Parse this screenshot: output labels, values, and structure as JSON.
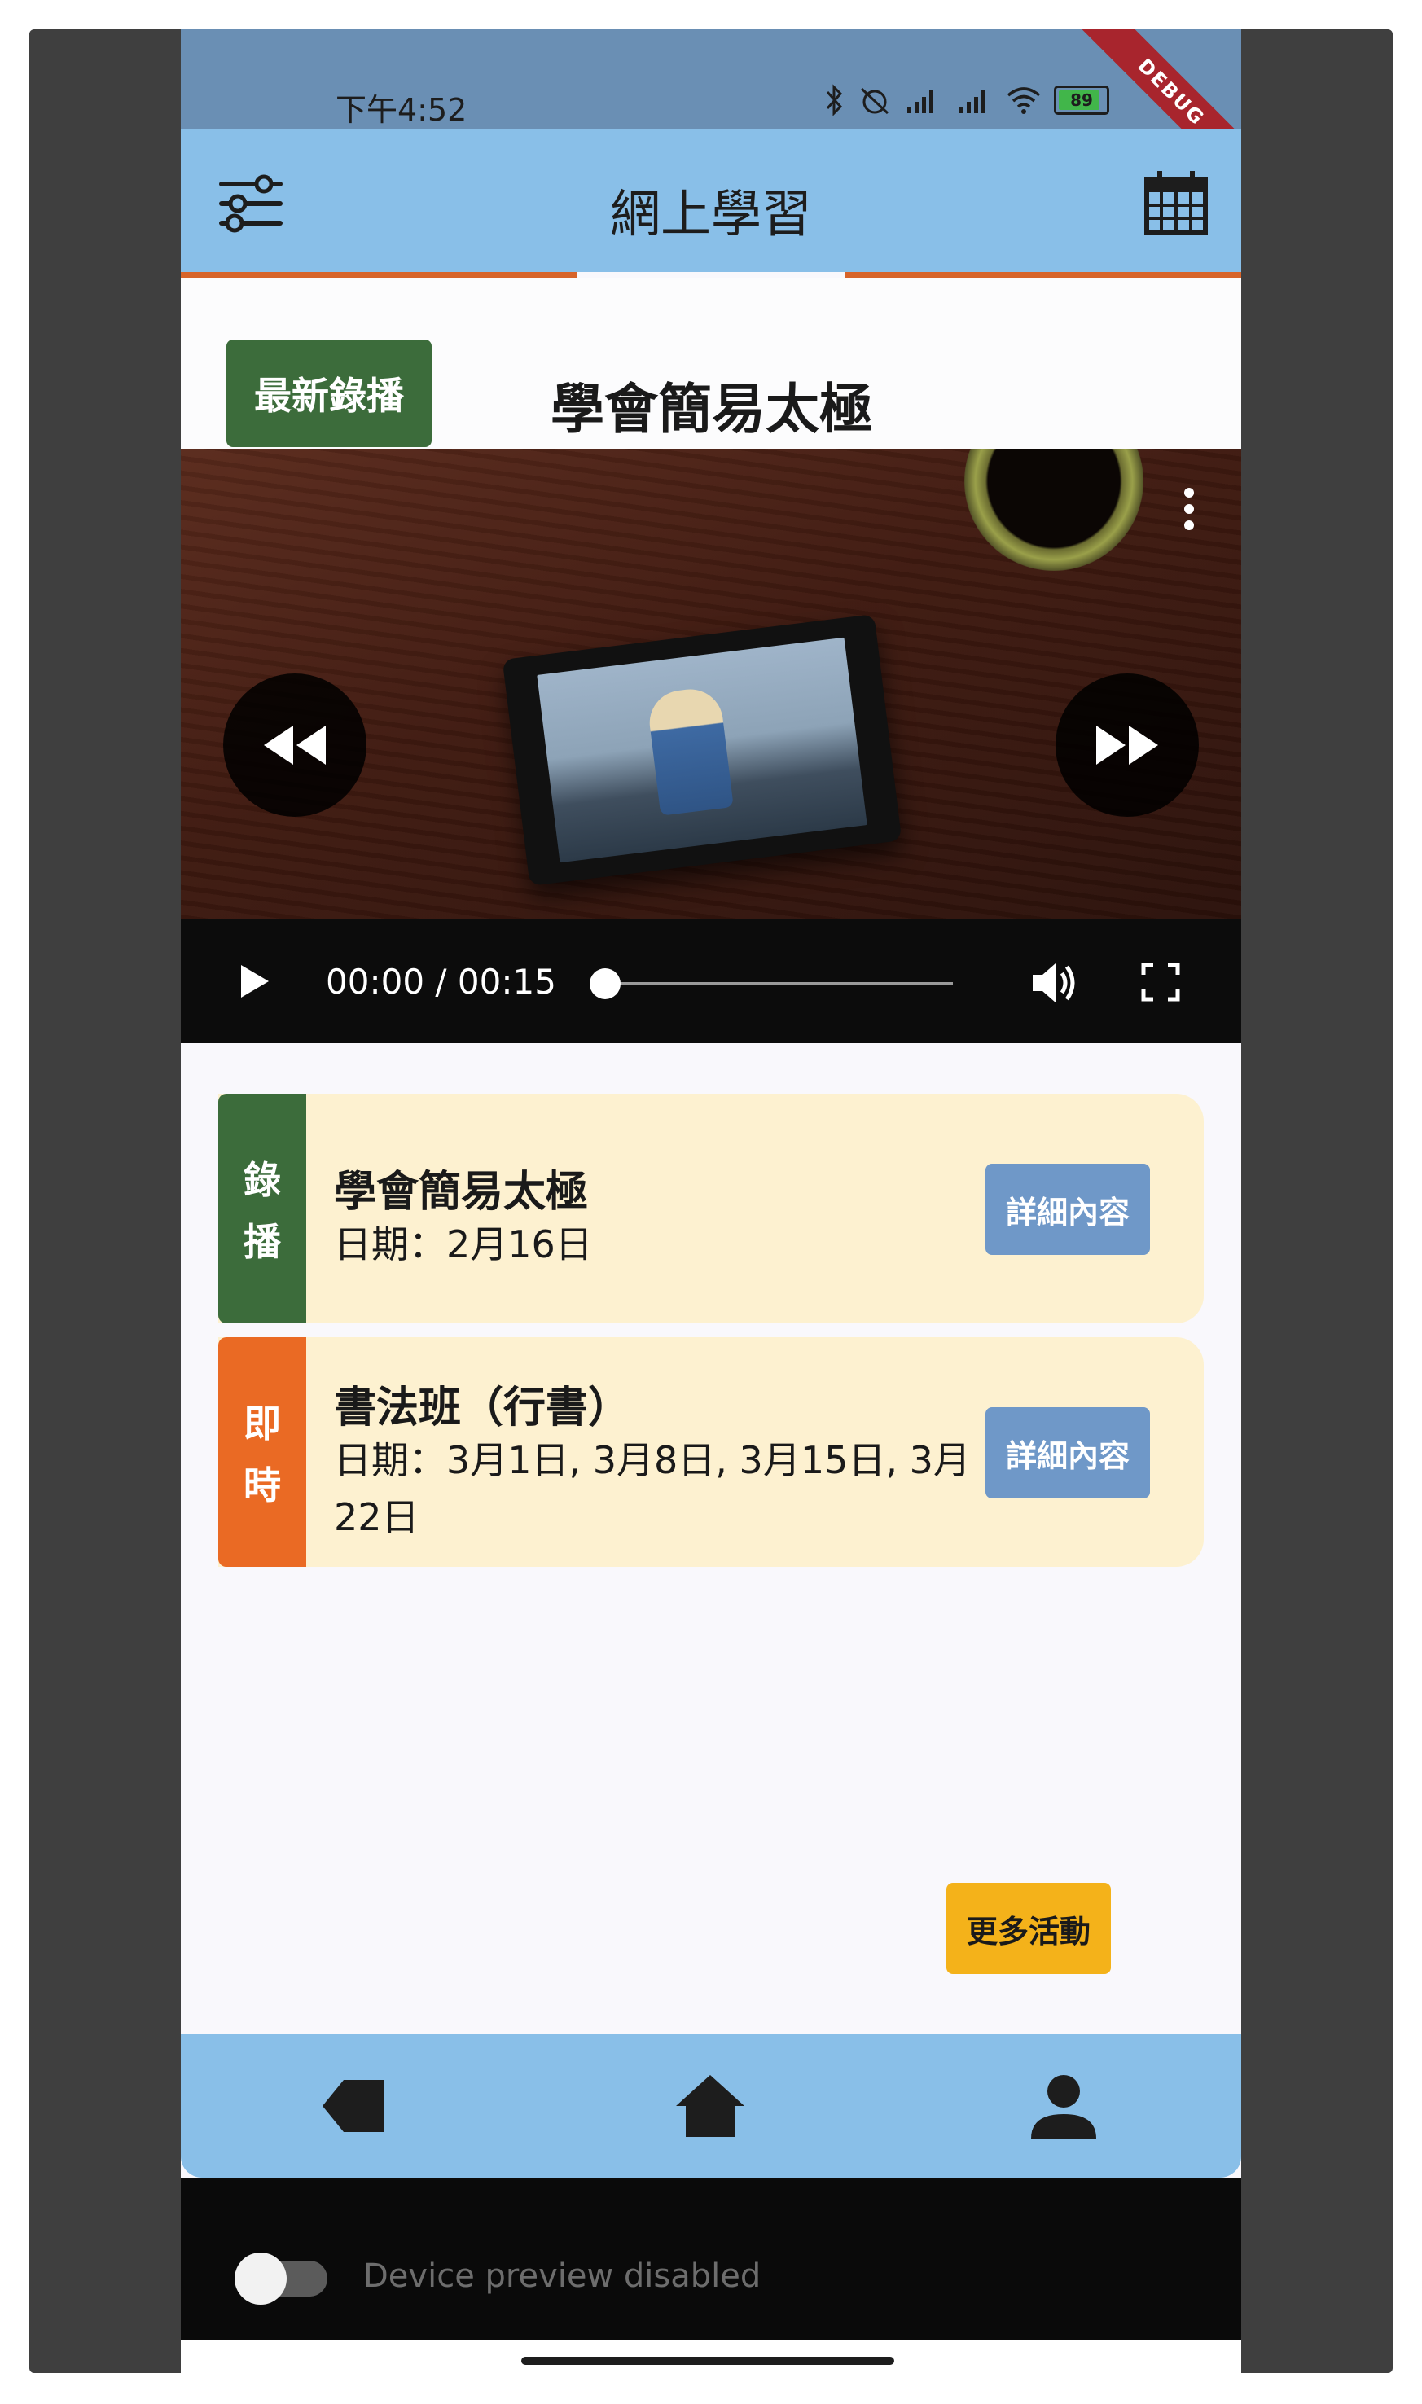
{
  "status_bar": {
    "time": "下午4:52",
    "battery_level": 89,
    "battery_text": "89",
    "debug_label": "DEBUG"
  },
  "app_bar": {
    "title": "網上學習",
    "left_icon": "filter-sliders-icon",
    "right_icon": "calendar-icon"
  },
  "featured": {
    "badge_label": "最新錄播",
    "title": "學會簡易太極"
  },
  "video_player": {
    "time_display": "00:00 / 00:15",
    "progress": 0,
    "icons": [
      "rewind-icon",
      "fast-forward-icon",
      "more-vert-icon",
      "play-icon",
      "volume-icon",
      "fullscreen-icon"
    ]
  },
  "activities": [
    {
      "tag": [
        "錄",
        "播"
      ],
      "tag_color": "#3c6c3b",
      "title": "學會簡易太極",
      "date": "日期：2月16日",
      "button_label": "詳細內容"
    },
    {
      "tag": [
        "即",
        "時"
      ],
      "tag_color": "#ea6a24",
      "title": "書法班（行書）",
      "date": "日期：3月1日, 3月8日, 3月15日, 3月22日",
      "button_label": "詳細內容"
    }
  ],
  "more_button": {
    "label": "更多活動"
  },
  "bottom_nav": {
    "items": [
      "back-icon",
      "home-icon",
      "person-icon"
    ]
  },
  "device_preview": {
    "label": "Device preview disabled",
    "enabled": false
  },
  "colors": {
    "app_bar": "#89bfe8",
    "status_bar": "#6a8fb4",
    "accent_underline": "#d7642a",
    "card_bg": "#fdf1d0",
    "detail_button": "#6f98c8",
    "more_button": "#f4b21a"
  }
}
